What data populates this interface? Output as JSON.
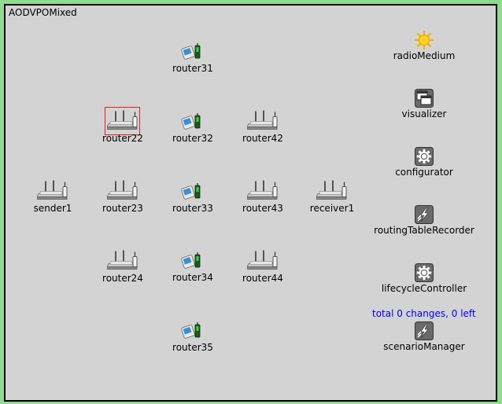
{
  "network": {
    "title": "AODVPOMixed"
  },
  "nodes": {
    "router31": "router31",
    "router22": "router22",
    "router32": "router32",
    "router42": "router42",
    "sender1": "sender1",
    "router23": "router23",
    "router33": "router33",
    "router43": "router43",
    "receiver1": "receiver1",
    "router24": "router24",
    "router34": "router34",
    "router44": "router44",
    "router35": "router35"
  },
  "modules": {
    "radioMedium": "radioMedium",
    "visualizer": "visualizer",
    "configurator": "configurator",
    "routingTableRecorder": "routingTableRecorder",
    "lifecycleController": "lifecycleController",
    "scenarioManager": "scenarioManager"
  },
  "scenario_status": "total 0 changes, 0 left",
  "selected_node": "router22",
  "icons": {
    "router": "wireless-router-icon",
    "pda": "pda-icon",
    "radioMedium": "sun-icon",
    "visualizer": "window-icon",
    "configurator": "gear-icon",
    "routingTableRecorder": "lightning-icon",
    "lifecycleController": "gear-icon",
    "scenarioManager": "lightning-icon"
  }
}
